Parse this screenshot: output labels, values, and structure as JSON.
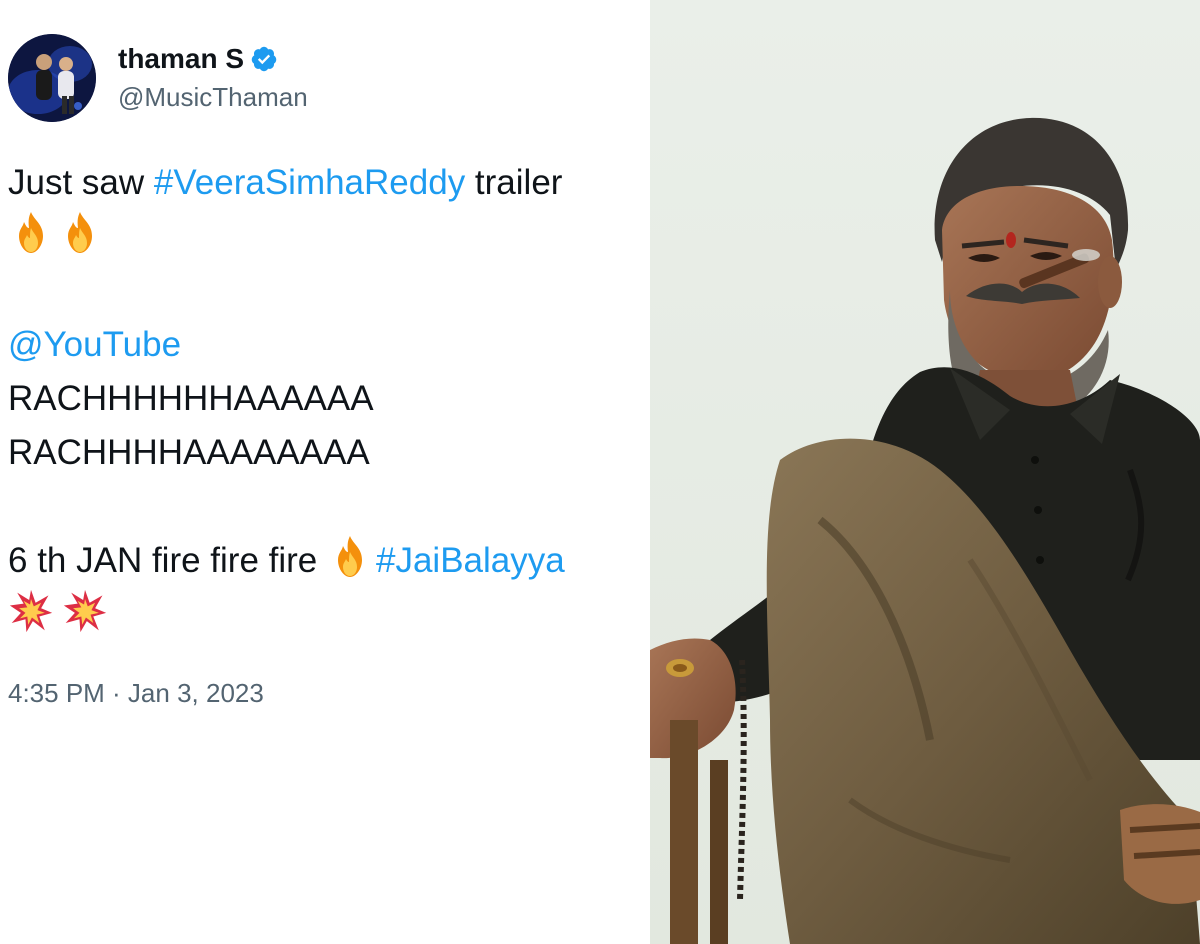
{
  "tweet": {
    "display_name": "thaman S",
    "handle": "@MusicThaman",
    "lines": {
      "l1_prefix": "Just saw ",
      "l1_hashtag": "#VeeraSimhaReddy",
      "l1_suffix": " trailer",
      "l3_mention": "@YouTube",
      "l4": "RACHHHHHHAAAAAA",
      "l5": "RACHHHHAAAAAAAA",
      "l6_prefix": "6 th JAN fire fire fire ",
      "l6_hashtag": "#JaiBalayya"
    },
    "timestamp": "4:35 PM · Jan 3, 2023"
  },
  "icons": {
    "verified": "verified-badge-icon",
    "fire": "fire-emoji-icon",
    "collision": "collision-emoji-icon"
  },
  "colors": {
    "link": "#1d9bf0",
    "text": "#0f1419",
    "muted": "#536471",
    "verified": "#1d9bf0"
  }
}
